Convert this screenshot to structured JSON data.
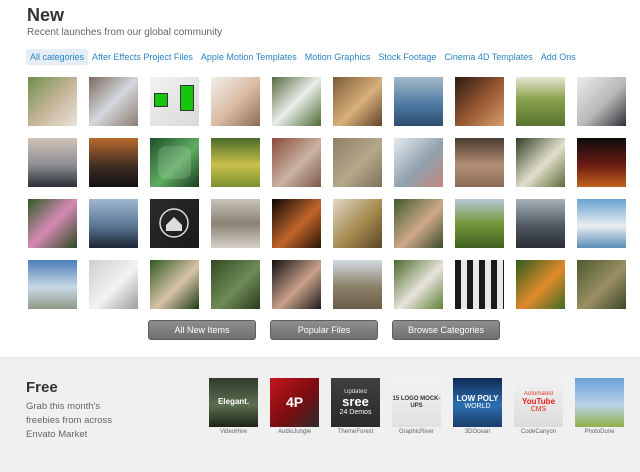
{
  "header": {
    "title": "New",
    "subtitle": "Recent launches from our global community"
  },
  "tabs": [
    {
      "label": "All categories",
      "active": true
    },
    {
      "label": "After Effects Project Files",
      "active": false
    },
    {
      "label": "Apple Motion Templates",
      "active": false
    },
    {
      "label": "Motion Graphics",
      "active": false
    },
    {
      "label": "Stock Footage",
      "active": false
    },
    {
      "label": "Cinema 4D Templates",
      "active": false
    },
    {
      "label": "Add Ons",
      "active": false
    }
  ],
  "thumbnails": [
    {
      "name": "bride-flowers",
      "bg": "linear-gradient(135deg,#6f8f4a,#c9b79c 55%,#e9e4dc)"
    },
    {
      "name": "tablet-hand",
      "bg": "linear-gradient(135deg,#7c6a5d,#d4d8de 50%,#8d7d70)"
    },
    {
      "name": "green-screen-devices",
      "bg": "linear-gradient(135deg,#f2f2f2,#d9d9d9)"
    },
    {
      "name": "woman-phone",
      "bg": "linear-gradient(135deg,#f3f0ec,#d7b89e 55%,#8a6a53)"
    },
    {
      "name": "swans",
      "bg": "linear-gradient(135deg,#596b3f,#e8eee9 50%,#4e6a34)"
    },
    {
      "name": "wood-closeup",
      "bg": "linear-gradient(135deg,#7b5b38,#d8b07a 55%,#5f4329)"
    },
    {
      "name": "sea-horizon",
      "bg": "linear-gradient(180deg,#a3b9c9,#4f7ba3 55%,#2f4d70)"
    },
    {
      "name": "hands-coin",
      "bg": "linear-gradient(135deg,#2d1a10,#9b5b34 55%,#d7a06f)"
    },
    {
      "name": "field",
      "bg": "linear-gradient(180deg,#e5e5d4,#8aa34c 45%,#56722e)"
    },
    {
      "name": "businessman-laptop",
      "bg": "linear-gradient(135deg,#ebebeb,#b8b8b8 55%,#2f3135)"
    },
    {
      "name": "sunset-lake",
      "bg": "linear-gradient(180deg,#d0c3b8,#8c8e92 55%,#2b2f36)"
    },
    {
      "name": "power-lines-sunset",
      "bg": "linear-gradient(180deg,#b86a2d,#3a2a22 60%,#121212)"
    },
    {
      "name": "nature-icon",
      "bg": "linear-gradient(135deg,#1e4f2a,#5fae62 55%,#163b1f)"
    },
    {
      "name": "yellow-flowers",
      "bg": "linear-gradient(180deg,#4a6b2a,#c9c24a 55%,#7a8f30)"
    },
    {
      "name": "brick-wall",
      "bg": "linear-gradient(135deg,#8a4b3b,#c9b3a2 55%,#7c5a4a)"
    },
    {
      "name": "stone-texture",
      "bg": "linear-gradient(135deg,#8f8168,#b4a78a 55%,#7c705b)"
    },
    {
      "name": "family-beach",
      "bg": "linear-gradient(135deg,#e6ebef,#8fa0ad 55%,#c48a7f)"
    },
    {
      "name": "dirt-ground",
      "bg": "linear-gradient(180deg,#4a3b31,#b58f76 55%,#8a6a55)"
    },
    {
      "name": "white-flowers",
      "bg": "linear-gradient(135deg,#2f3f26,#e4e0cc 55%,#5a6b3a)"
    },
    {
      "name": "fruits",
      "bg": "linear-gradient(180deg,#0d0d0d,#6b1b13 55%,#c2631d)"
    },
    {
      "name": "pink-flowers",
      "bg": "linear-gradient(135deg,#2e5b25,#d58ab4 50%,#2c4a22)"
    },
    {
      "name": "man-pier",
      "bg": "linear-gradient(180deg,#9fb6cf,#5a7694 55%,#1c2634)"
    },
    {
      "name": "home-icon",
      "bg": "linear-gradient(135deg,#2b2b2b,#1a1a1a)"
    },
    {
      "name": "water-shore",
      "bg": "linear-gradient(180deg,#c8c2b8,#8b8275 50%,#d6d0c6)"
    },
    {
      "name": "woman-fire",
      "bg": "linear-gradient(135deg,#0c0704,#c2662b 55%,#271507)"
    },
    {
      "name": "coffee-table",
      "bg": "linear-gradient(135deg,#e0d8c8,#a5894d 55%,#59452a)"
    },
    {
      "name": "man-portrait",
      "bg": "linear-gradient(135deg,#3f5a2b,#cfa98a 55%,#394b2c)"
    },
    {
      "name": "grass-field",
      "bg": "linear-gradient(180deg,#b7c9d6,#76973a 50%,#3f6020)"
    },
    {
      "name": "city-towers",
      "bg": "linear-gradient(180deg,#a7b1b8,#4f5760 55%,#2a2f34)"
    },
    {
      "name": "beach-chairs",
      "bg": "linear-gradient(180deg,#6aa2d0,#e9eef1 55%,#5a8db6)"
    },
    {
      "name": "building-sky",
      "bg": "linear-gradient(180deg,#4b7db8,#c9d8e6 55%,#8f9a86)"
    },
    {
      "name": "paper-hands",
      "bg": "linear-gradient(135deg,#cfcfcf,#f2f2f2 55%,#9c9c9c)"
    },
    {
      "name": "woman-forest",
      "bg": "linear-gradient(135deg,#2f5a1f,#d7c3a9 55%,#1f3b15)"
    },
    {
      "name": "tree-close",
      "bg": "linear-gradient(135deg,#334b24,#6f8a55 55%,#273a1b)"
    },
    {
      "name": "woman-hair",
      "bg": "linear-gradient(135deg,#101010,#caa08a 55%,#1c1c1c)"
    },
    {
      "name": "city-aerial",
      "bg": "linear-gradient(180deg,#d3dbe1,#8c8069 55%,#6a5c48)"
    },
    {
      "name": "dog-grass",
      "bg": "linear-gradient(135deg,#4b6b2a,#e8e4dc 55%,#5e7f36)"
    },
    {
      "name": "crosswalk",
      "bg": "repeating-linear-gradient(90deg,#1a1a1a 0 6px,#e8e8e8 6px 12px)"
    },
    {
      "name": "orange-flowers",
      "bg": "linear-gradient(135deg,#2f5a1f,#e08a2a 55%,#3c6b25)"
    },
    {
      "name": "frog",
      "bg": "linear-gradient(135deg,#4a5a2f,#9b8f63 55%,#3b4826)"
    }
  ],
  "buttons": [
    {
      "label": "All New Items"
    },
    {
      "label": "Popular Files"
    },
    {
      "label": "Browse Categories"
    }
  ],
  "free": {
    "title": "Free",
    "text": "Grab this month's freebies from across Envato Market",
    "items": [
      {
        "caption": "VideoHive",
        "overlay": "Elegant.",
        "bg": "linear-gradient(180deg,#2f3b2b,#5c6e50 55%,#1c2418)",
        "color": "#ffffff"
      },
      {
        "caption": "AudioJungle",
        "overlay": "4P",
        "bg": "linear-gradient(135deg,#c4161c,#7a0d10 55%,#2b2b2b)",
        "color": "#ffffff"
      },
      {
        "caption": "ThemeForest",
        "overlay": "sree",
        "sub": "24 Demos",
        "top": "Updated",
        "bg": "linear-gradient(180deg,#3f3f3f,#2a2a2a)",
        "color": "#ffffff"
      },
      {
        "caption": "GraphicRiver",
        "overlay": "15 LOGO MOCK-UPS",
        "bg": "linear-gradient(180deg,#f4f4f4,#e0e0e0)",
        "color": "#333333"
      },
      {
        "caption": "3DOcean",
        "overlay": "LOW POLY",
        "sub": "WORLD",
        "bg": "linear-gradient(180deg,#0f2a54,#2d6fb0 55%,#1a3d6b)",
        "color": "#ffffff"
      },
      {
        "caption": "CodeCanyon",
        "overlay": "YouTube",
        "sub": "CMS",
        "top": "Automated",
        "bg": "linear-gradient(180deg,#f2f2f2,#dcdcdc)",
        "color": "#e62117"
      },
      {
        "caption": "PhotoDune",
        "overlay": "",
        "bg": "linear-gradient(180deg,#6aa0d6,#b8d2e8 55%,#8fb04a)",
        "color": "#ffffff"
      }
    ]
  }
}
